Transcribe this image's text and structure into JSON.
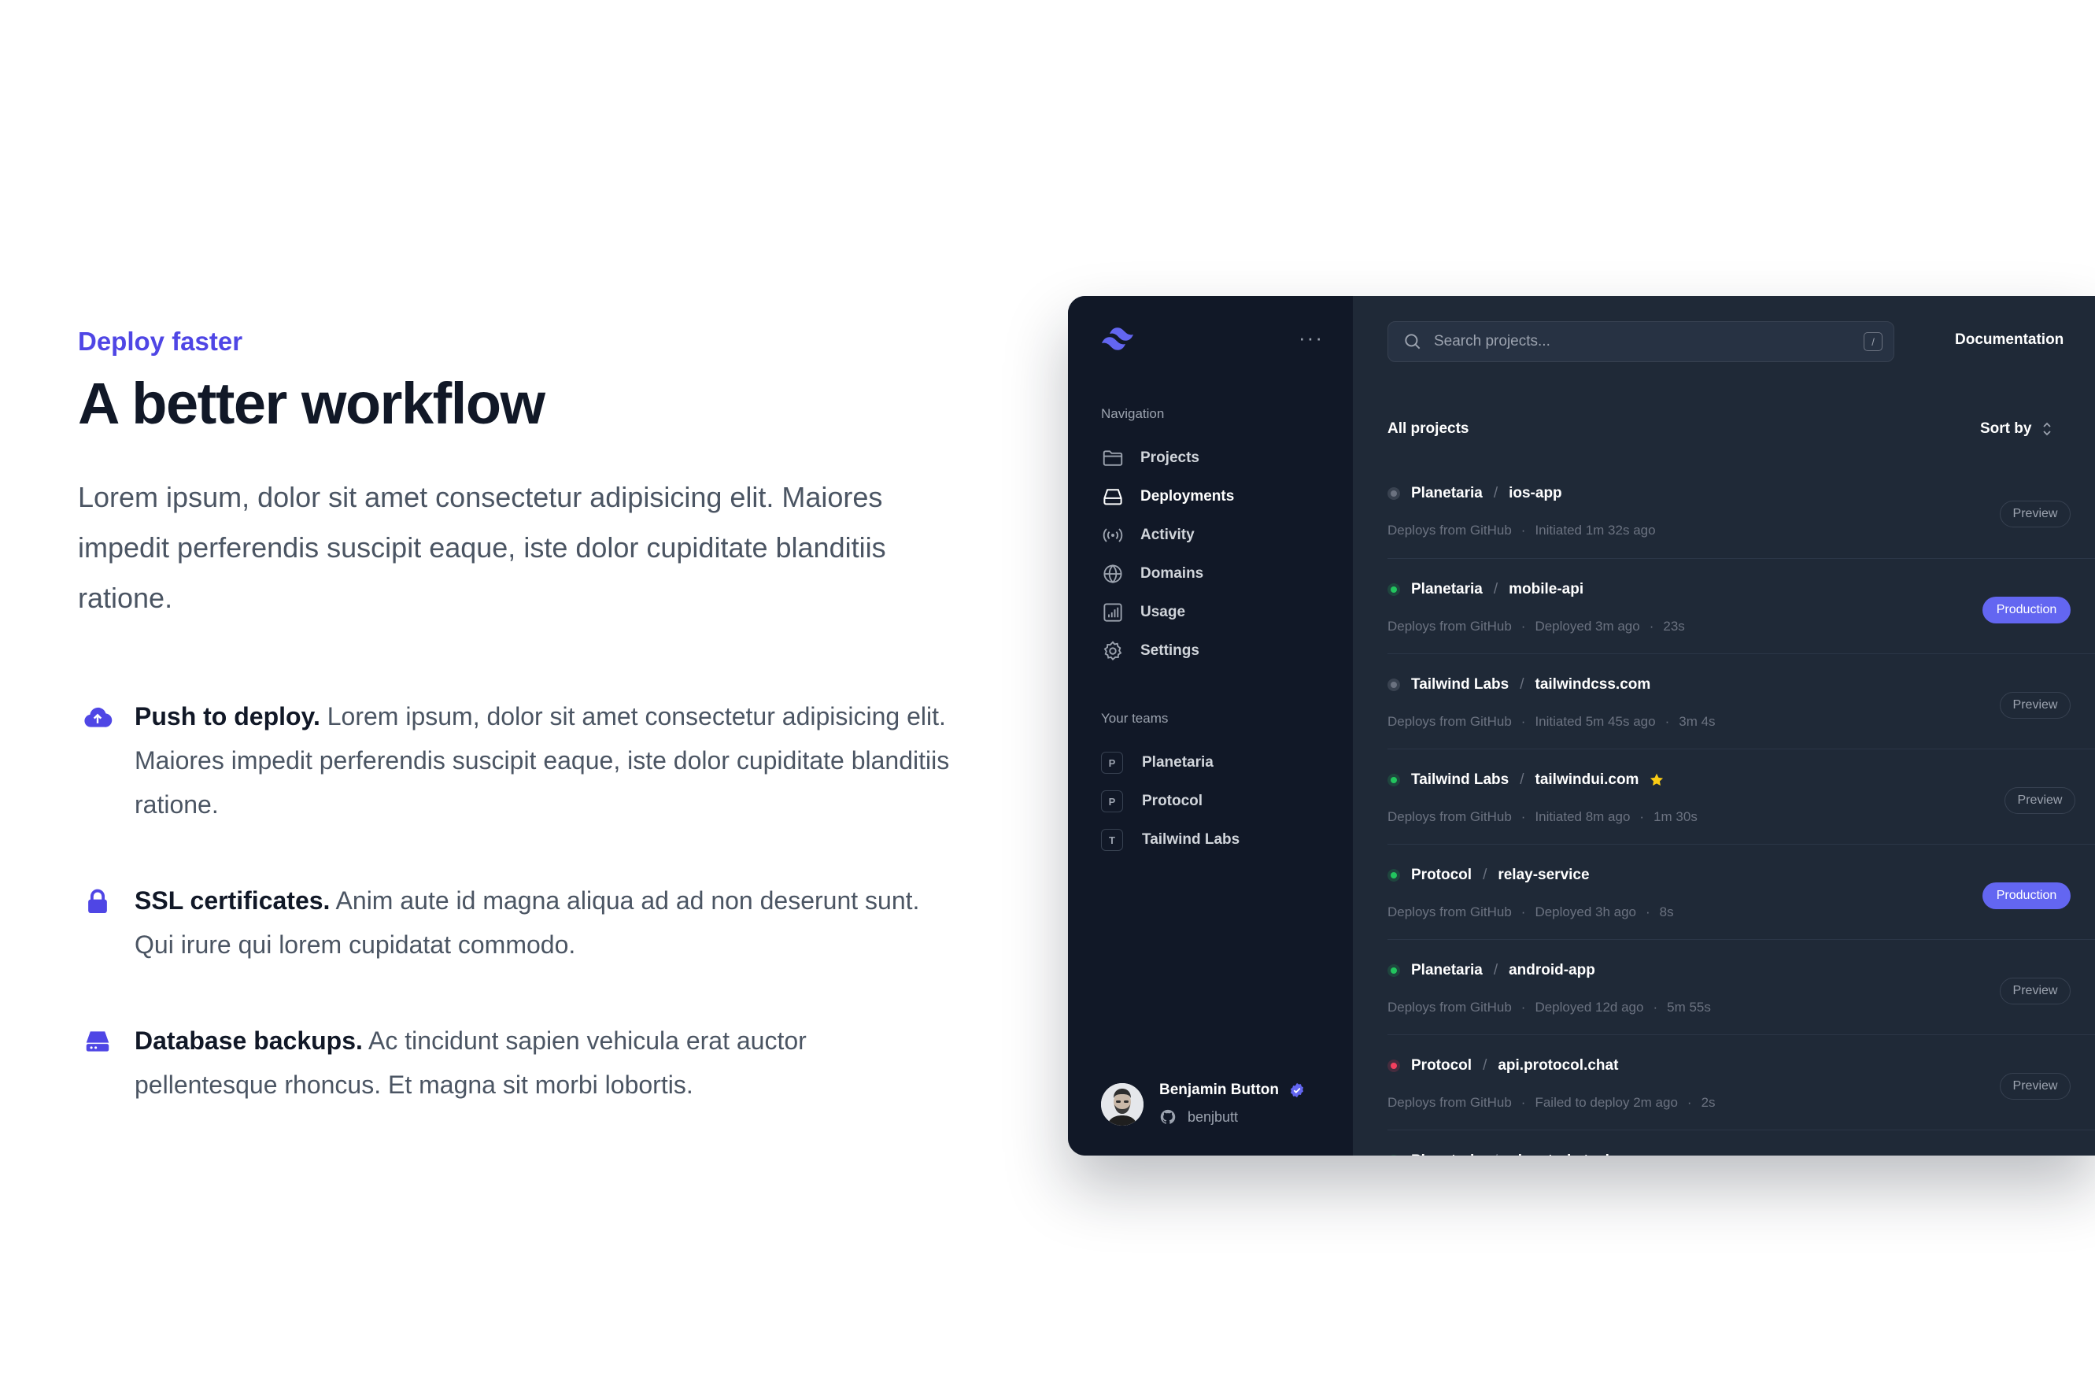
{
  "hero": {
    "eyebrow": "Deploy faster",
    "title": "A better workflow",
    "lead": "Lorem ipsum, dolor sit amet consectetur adipisicing elit. Maiores impedit perferendis suscipit eaque, iste dolor cupiditate blanditiis ratione."
  },
  "features": [
    {
      "icon": "cloud-upload-icon",
      "name": "Push to deploy.",
      "text": " Lorem ipsum, dolor sit amet consectetur adipisicing elit. Maiores impedit perferendis suscipit eaque, iste dolor cupiditate blanditiis ratione."
    },
    {
      "icon": "lock-icon",
      "name": "SSL certificates.",
      "text": " Anim aute id magna aliqua ad ad non deserunt sunt. Qui irure qui lorem cupidatat commodo."
    },
    {
      "icon": "server-icon",
      "name": "Database backups.",
      "text": " Ac tincidunt sapien vehicula erat auctor pellentesque rhoncus. Et magna sit morbi lobortis."
    }
  ],
  "app": {
    "sidebar": {
      "more_label": "···",
      "nav_heading": "Navigation",
      "nav": [
        {
          "label": "Projects",
          "icon": "folder-icon"
        },
        {
          "label": "Deployments",
          "icon": "server-icon"
        },
        {
          "label": "Activity",
          "icon": "signal-icon"
        },
        {
          "label": "Domains",
          "icon": "globe-icon"
        },
        {
          "label": "Usage",
          "icon": "chart-bar-icon"
        },
        {
          "label": "Settings",
          "icon": "gear-icon"
        }
      ],
      "teams_heading": "Your teams",
      "teams": [
        {
          "initial": "P",
          "label": "Planetaria"
        },
        {
          "initial": "P",
          "label": "Protocol"
        },
        {
          "initial": "T",
          "label": "Tailwind Labs"
        }
      ],
      "user": {
        "name": "Benjamin Button",
        "handle": "benjbutt"
      }
    },
    "search": {
      "placeholder": "Search projects...",
      "shortcut": "/"
    },
    "header_link": "Documentation",
    "list_title": "All projects",
    "sort_label": "Sort by",
    "colors": {
      "accent": "#6366f1",
      "ok": "#22c55e",
      "error": "#f43f5e",
      "idle": "#6b7280"
    },
    "deployments": [
      {
        "team": "Planetaria",
        "project": "ios-app",
        "status": "idle",
        "source": "Deploys from GitHub",
        "info": "Initiated 1m 32s ago",
        "duration": "",
        "env": "Preview",
        "starred": false
      },
      {
        "team": "Planetaria",
        "project": "mobile-api",
        "status": "ok",
        "source": "Deploys from GitHub",
        "info": "Deployed 3m ago",
        "duration": "23s",
        "env": "Production",
        "starred": false
      },
      {
        "team": "Tailwind Labs",
        "project": "tailwindcss.com",
        "status": "idle",
        "source": "Deploys from GitHub",
        "info": "Initiated 5m 45s ago",
        "duration": "3m 4s",
        "env": "Preview",
        "starred": false
      },
      {
        "team": "Tailwind Labs",
        "project": "tailwindui.com",
        "status": "ok",
        "source": "Deploys from GitHub",
        "info": "Initiated 8m ago",
        "duration": "1m 30s",
        "env": "Preview",
        "starred": true
      },
      {
        "team": "Protocol",
        "project": "relay-service",
        "status": "ok",
        "source": "Deploys from GitHub",
        "info": "Deployed 3h ago",
        "duration": "8s",
        "env": "Production",
        "starred": false
      },
      {
        "team": "Planetaria",
        "project": "android-app",
        "status": "ok",
        "source": "Deploys from GitHub",
        "info": "Deployed 12d ago",
        "duration": "5m 55s",
        "env": "Preview",
        "starred": false
      },
      {
        "team": "Protocol",
        "project": "api.protocol.chat",
        "status": "error",
        "source": "Deploys from GitHub",
        "info": "Failed to deploy 2m ago",
        "duration": "2s",
        "env": "Preview",
        "starred": false
      },
      {
        "team": "Planetaria",
        "project": "planetaria.tech",
        "status": "ok",
        "source": "",
        "info": "",
        "duration": "",
        "env": "",
        "starred": false
      }
    ]
  }
}
